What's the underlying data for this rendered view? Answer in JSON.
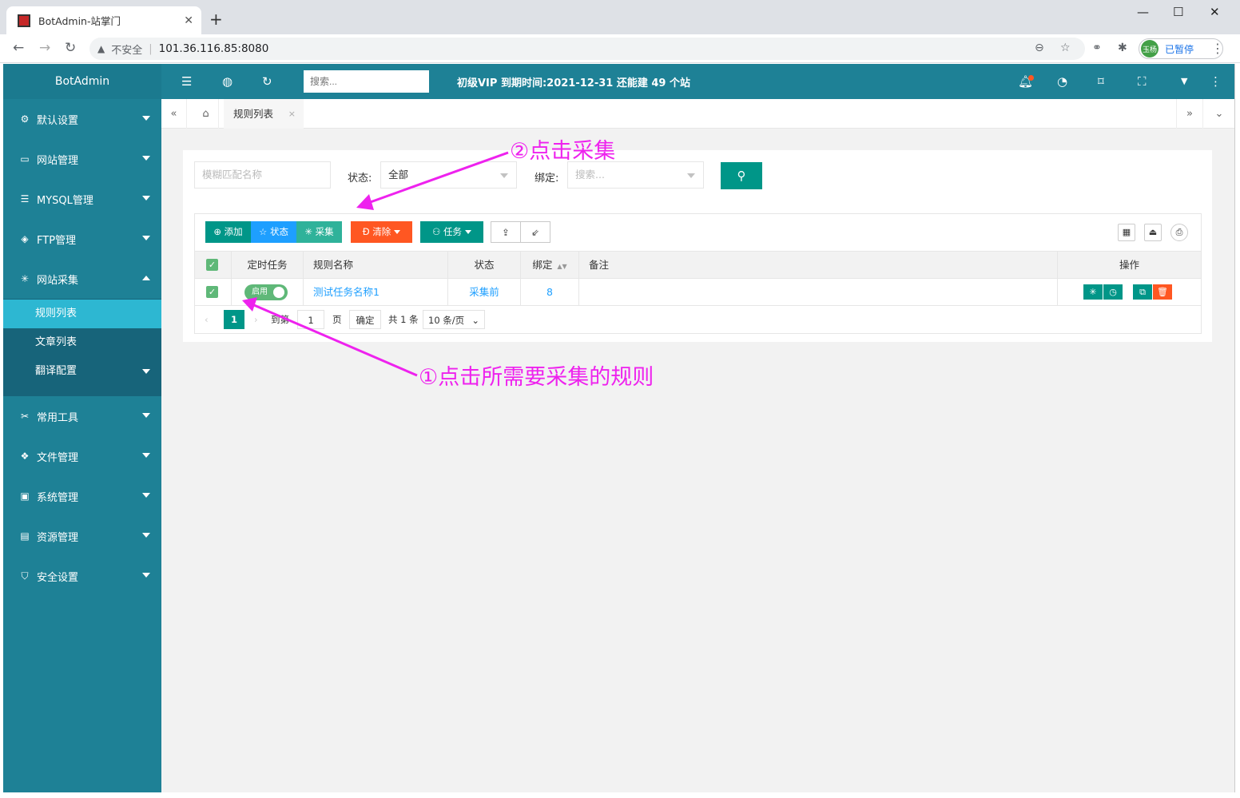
{
  "browser": {
    "tab_title": "BotAdmin-站掌门",
    "tab_close": "✕",
    "new_tab": "+",
    "minimize": "—",
    "maximize": "☐",
    "close": "✕",
    "insecure_label": "不安全",
    "url": "101.36.116.85:8080",
    "profile_avatar": "玉杨",
    "profile_label": "已暂停"
  },
  "app": {
    "logo": "BotAdmin",
    "search_placeholder": "搜索...",
    "notice": "初级VIP 到期时间:2021-12-31 还能建 49 个站"
  },
  "sidebar": {
    "items": [
      {
        "label": "默认设置",
        "icon": "gear-icon"
      },
      {
        "label": "网站管理",
        "icon": "monitor-icon"
      },
      {
        "label": "MYSQL管理",
        "icon": "database-icon"
      },
      {
        "label": "FTP管理",
        "icon": "ftp-icon"
      },
      {
        "label": "网站采集",
        "icon": "spider-icon"
      }
    ],
    "submenu": [
      {
        "label": "规则列表"
      },
      {
        "label": "文章列表"
      },
      {
        "label": "翻译配置"
      }
    ],
    "items_after": [
      {
        "label": "常用工具",
        "icon": "tools-icon"
      },
      {
        "label": "文件管理",
        "icon": "files-icon"
      },
      {
        "label": "系统管理",
        "icon": "system-icon"
      },
      {
        "label": "资源管理",
        "icon": "resource-icon"
      },
      {
        "label": "安全设置",
        "icon": "shield-icon"
      }
    ]
  },
  "tabs": {
    "current": "规则列表",
    "close": "×"
  },
  "filters": {
    "name_placeholder": "模糊匹配名称",
    "status_label": "状态:",
    "status_value": "全部",
    "bind_label": "绑定:",
    "bind_placeholder": "搜索..."
  },
  "toolbar": {
    "add": "添加",
    "status": "状态",
    "collect": "采集",
    "clear": "清除",
    "task": "任务"
  },
  "table": {
    "headers": [
      "定时任务",
      "规则名称",
      "状态",
      "绑定",
      "备注",
      "操作"
    ],
    "rows": [
      {
        "switch": "启用",
        "name": "测试任务名称1",
        "status": "采集前",
        "bind": "8",
        "note": ""
      }
    ]
  },
  "pager": {
    "current": "1",
    "goto_label": "到第",
    "page_input": "1",
    "page_unit": "页",
    "confirm": "确定",
    "total": "共 1 条",
    "per_page": "10 条/页"
  },
  "annotations": {
    "step1": "①点击所需要采集的规则",
    "step2": "②点击采集"
  },
  "colors": {
    "sidebar": "#1e8196",
    "accent": "#009688",
    "annotation": "#ee22ee"
  }
}
